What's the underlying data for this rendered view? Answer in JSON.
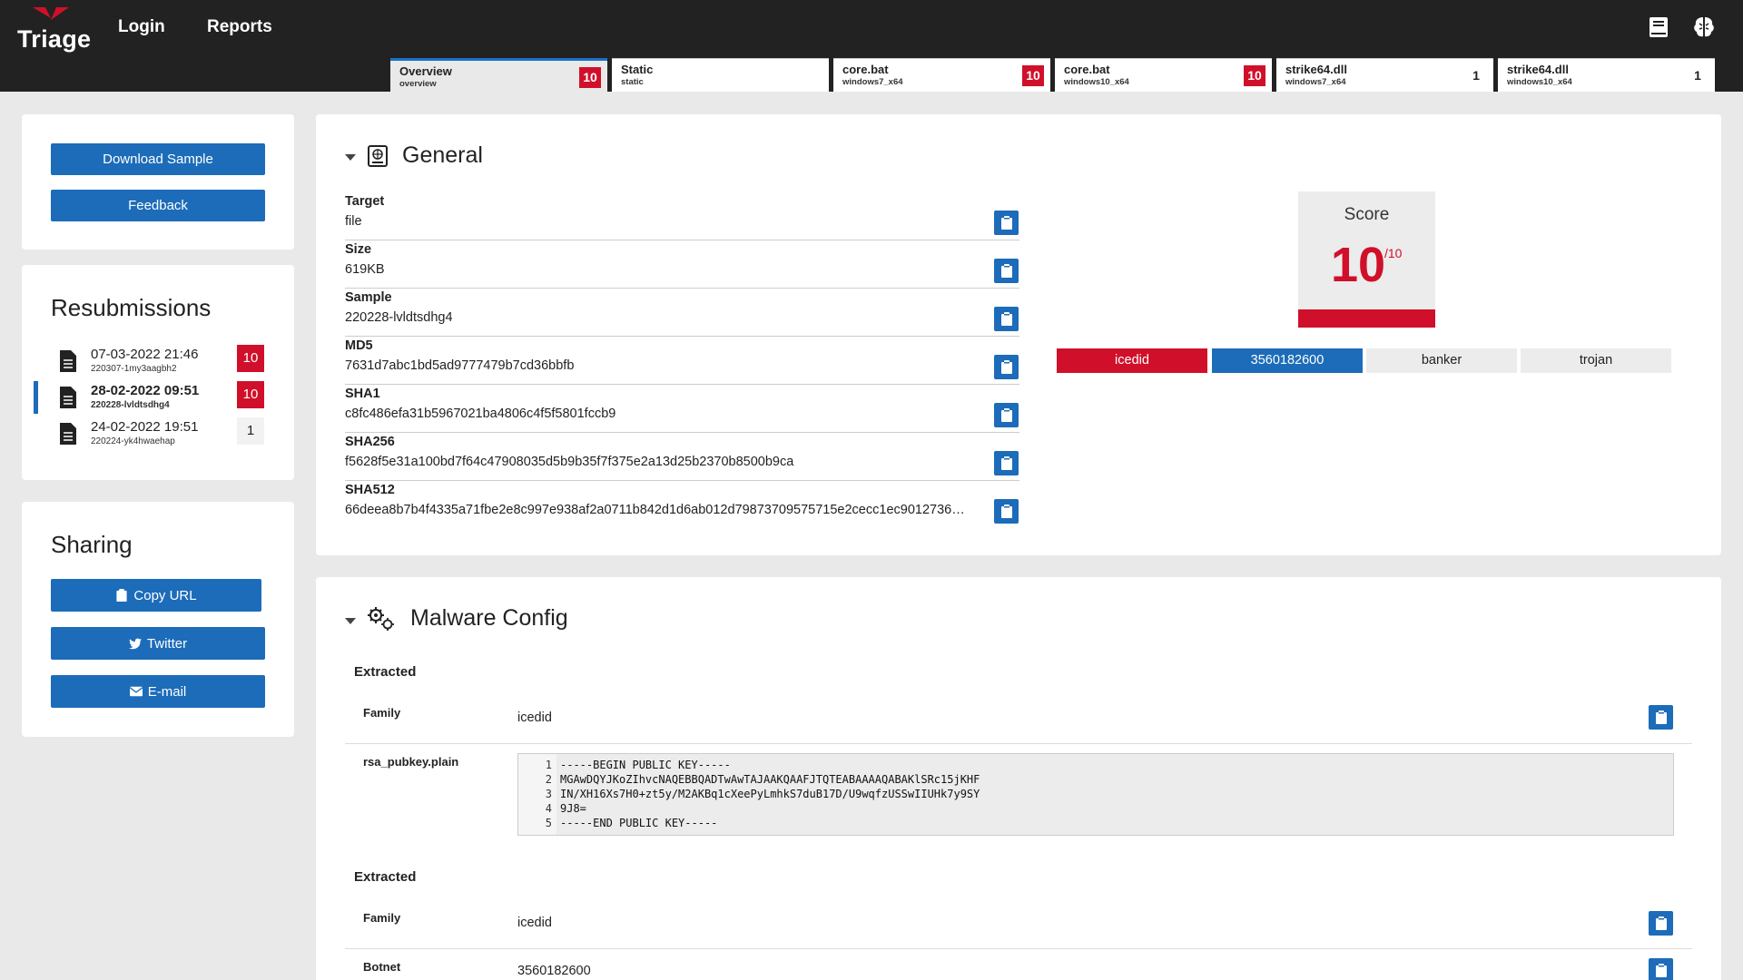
{
  "header": {
    "logo_text": "Triage",
    "nav": [
      "Login",
      "Reports"
    ],
    "icons": [
      "book-icon",
      "brain-icon"
    ]
  },
  "tabs": [
    {
      "title": "Overview",
      "sub": "overview",
      "score": "10",
      "active": true
    },
    {
      "title": "Static",
      "sub": "static",
      "score": "",
      "active": false
    },
    {
      "title": "core.bat",
      "sub": "windows7_x64",
      "score": "10",
      "active": false
    },
    {
      "title": "core.bat",
      "sub": "windows10_x64",
      "score": "10",
      "active": false
    },
    {
      "title": "strike64.dll",
      "sub": "windows7_x64",
      "score": "1",
      "active": false
    },
    {
      "title": "strike64.dll",
      "sub": "windows10_x64",
      "score": "1",
      "active": false
    }
  ],
  "actions": {
    "download": "Download Sample",
    "feedback": "Feedback"
  },
  "resubmissions": {
    "title": "Resubmissions",
    "items": [
      {
        "date": "07-03-2022 21:46",
        "id": "220307-1my3aagbh2",
        "score": "10",
        "current": false
      },
      {
        "date": "28-02-2022 09:51",
        "id": "220228-lvldtsdhg4",
        "score": "10",
        "current": true
      },
      {
        "date": "24-02-2022 19:51",
        "id": "220224-yk4hwaehap",
        "score": "1",
        "current": false
      }
    ]
  },
  "sharing": {
    "title": "Sharing",
    "copy": "Copy URL",
    "twitter": "Twitter",
    "email": "E-mail"
  },
  "general": {
    "title": "General",
    "fields": [
      {
        "key": "Target",
        "value": "file"
      },
      {
        "key": "Size",
        "value": "619KB"
      },
      {
        "key": "Sample",
        "value": "220228-lvldtsdhg4"
      },
      {
        "key": "MD5",
        "value": "7631d7abc1bd5ad9777479b7cd36bbfb"
      },
      {
        "key": "SHA1",
        "value": "c8fc486efa31b5967021ba4806c4f5f5801fccb9"
      },
      {
        "key": "SHA256",
        "value": "f5628f5e31a100bd7f64c47908035d5b9b35f7f375e2a13d25b2370b8500b9ca"
      },
      {
        "key": "SHA512",
        "value": "66deea8b7b4f4335a71fbe2e8c997e938af2a0711b842d1d6ab012d79873709575715e2cecc1ec9012736…"
      }
    ],
    "score": {
      "label": "Score",
      "value": "10",
      "max": "/10"
    },
    "tags": [
      "icedid",
      "3560182600",
      "banker",
      "trojan"
    ]
  },
  "malware_config": {
    "title": "Malware Config",
    "blocks": [
      {
        "heading": "Extracted",
        "family_label": "Family",
        "family": "icedid",
        "rsa_label": "rsa_pubkey.plain",
        "code": [
          "-----BEGIN PUBLIC KEY-----",
          "MGAwDQYJKoZIhvcNAQEBBQADTwAwTAJAAKQAAFJTQTEABAAAAQABAKlSRc15jKHF",
          "IN/XH16Xs7H0+zt5y/M2AKBq1cXeePyLmhkS7duB17D/U9wqfzUSSwIIUHk7y9SY",
          "9J8=",
          "-----END PUBLIC KEY-----"
        ],
        "line_numbers": [
          "1",
          "2",
          "3",
          "4",
          "5"
        ]
      },
      {
        "heading": "Extracted",
        "family_label": "Family",
        "family": "icedid",
        "botnet_label": "Botnet",
        "botnet": "3560182600"
      }
    ]
  },
  "colors": {
    "red": "#d0102a",
    "blue": "#1c6cb9",
    "dark": "#222222"
  }
}
